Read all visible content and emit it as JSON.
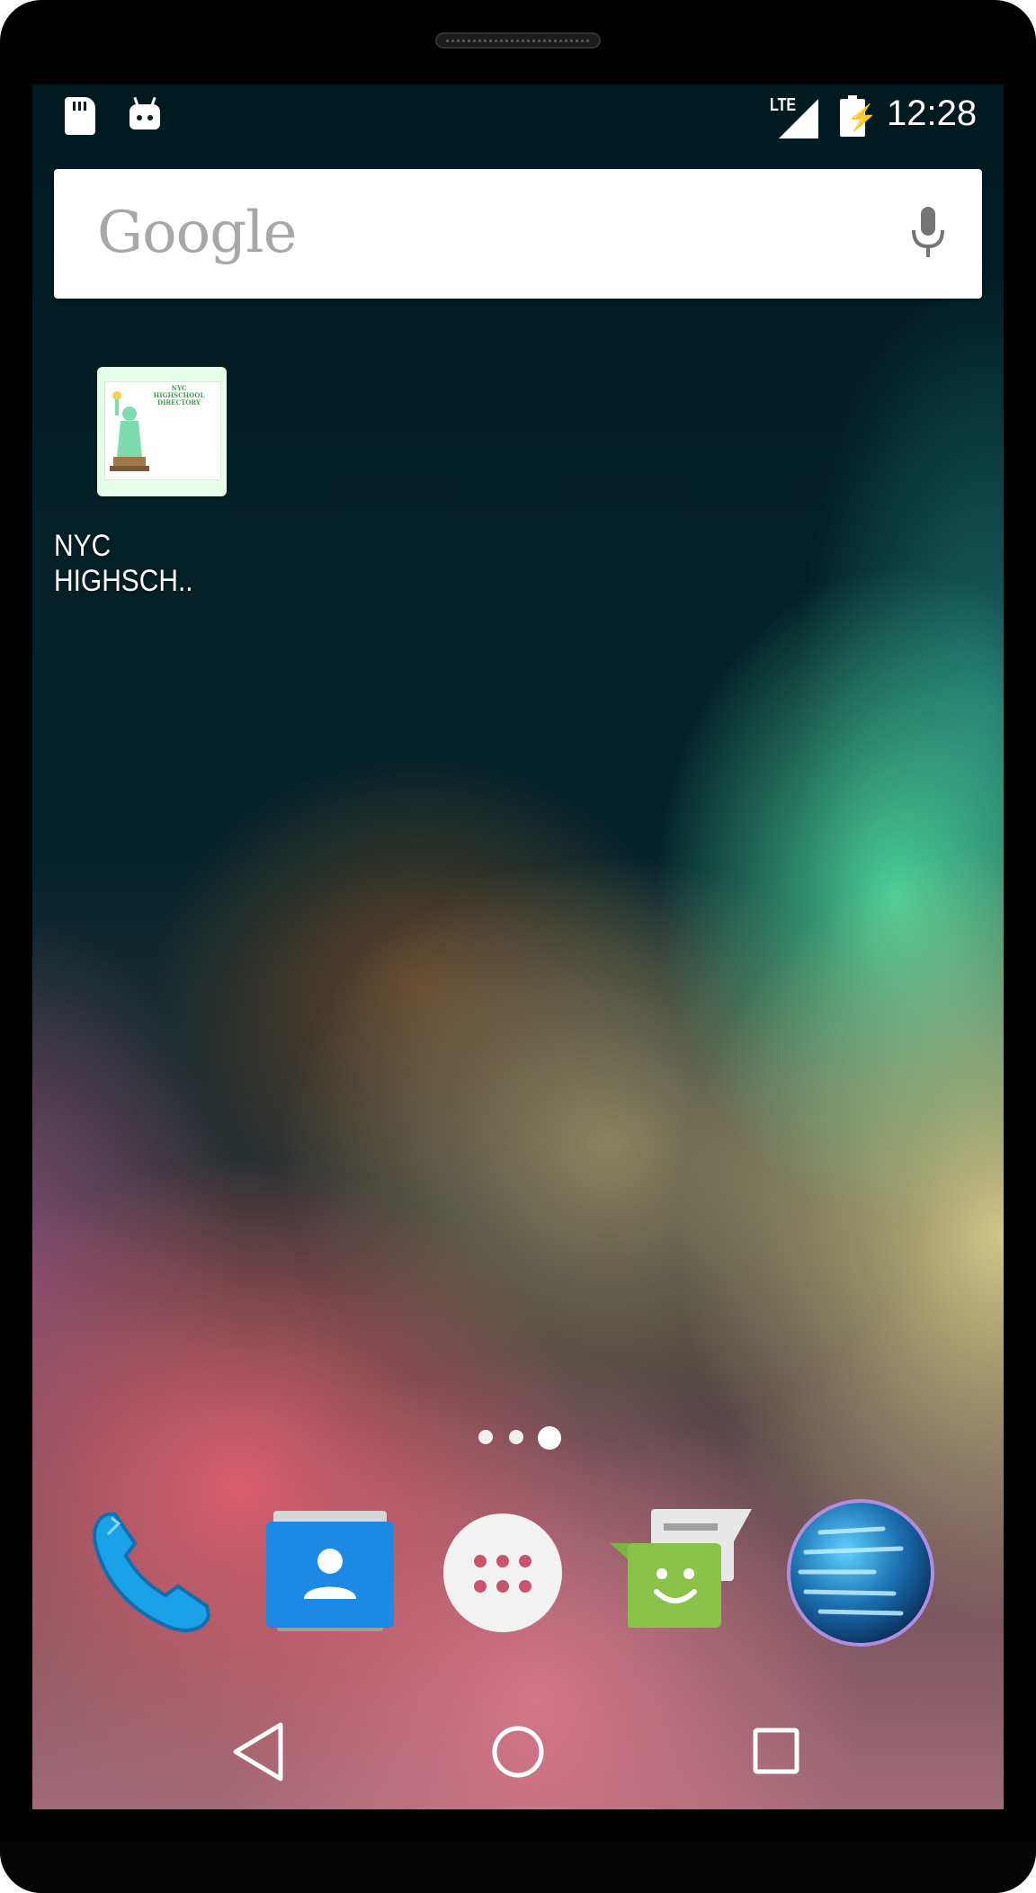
{
  "status_bar": {
    "network_type": "LTE",
    "time": "12:28",
    "icons": [
      "sd-card-icon",
      "android-debug-icon",
      "signal-icon",
      "battery-charging-icon"
    ]
  },
  "search_widget": {
    "logo_text": "Google",
    "icons": [
      "mic-icon"
    ]
  },
  "home_screen": {
    "shortcuts": [
      {
        "label": "NYC HIGHSCH..",
        "icon": "nyc-highschool-directory-icon",
        "icon_text": "NYC HIGHSCHOOL DIRECTORY"
      }
    ],
    "page_indicator": {
      "pages": 3,
      "current": 3
    }
  },
  "dock": {
    "apps": [
      {
        "name": "Phone",
        "icon": "phone-icon"
      },
      {
        "name": "Contacts",
        "icon": "contacts-icon"
      },
      {
        "name": "All apps",
        "icon": "app-drawer-icon"
      },
      {
        "name": "Messaging",
        "icon": "messaging-icon"
      },
      {
        "name": "Browser",
        "icon": "globe-icon"
      }
    ]
  },
  "nav_bar": {
    "buttons": [
      "back-icon",
      "home-icon",
      "recents-icon"
    ]
  },
  "colors": {
    "status_text": "#ffffff",
    "search_bg": "#ffffff",
    "logo_gray": "#a8a8a8",
    "phone_blue": "#1aa1e8",
    "contacts_blue": "#1e88e5",
    "message_green": "#8bc34a"
  }
}
